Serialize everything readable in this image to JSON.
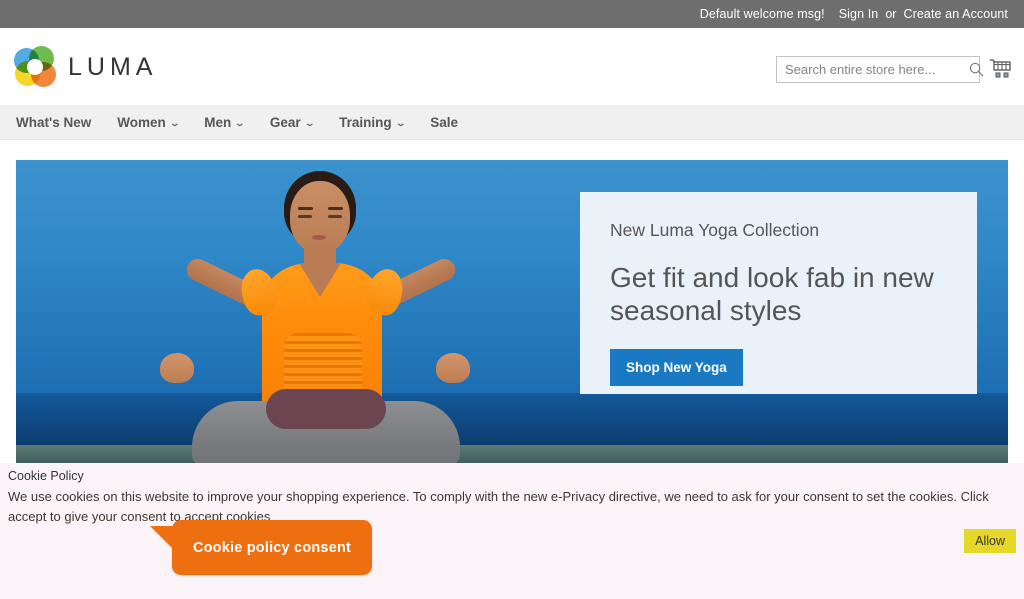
{
  "topbar": {
    "welcome": "Default welcome msg!",
    "sign_in": "Sign In",
    "separator": "or",
    "create_account": "Create an Account"
  },
  "header": {
    "logo_text": "LUMA",
    "logo_icon": "luma-ring-logo",
    "search": {
      "placeholder": "Search entire store here...",
      "value": "",
      "icon": "search-icon"
    },
    "cart_icon": "shopping-cart-icon"
  },
  "nav": {
    "items": [
      {
        "label": "What's New",
        "has_caret": false
      },
      {
        "label": "Women",
        "has_caret": true
      },
      {
        "label": "Men",
        "has_caret": true
      },
      {
        "label": "Gear",
        "has_caret": true
      },
      {
        "label": "Training",
        "has_caret": true
      },
      {
        "label": "Sale",
        "has_caret": false
      }
    ],
    "caret_glyph": "⌄"
  },
  "hero": {
    "eyebrow": "New Luma Yoga Collection",
    "title": "Get fit and look fab in new seasonal styles",
    "cta_label": "Shop New Yoga",
    "image_alt": "Woman meditating in lotus pose on a beach wearing an orange top and grey yoga pants"
  },
  "cookie": {
    "title": "Cookie Policy",
    "text": "We use cookies on this website to improve your shopping experience. To comply with the new e-Privacy directive, we need to ask for your consent to set the cookies. Click accept to give your consent to accept cookies",
    "allow_label": "Allow"
  },
  "callout": {
    "label": "Cookie policy consent"
  },
  "colors": {
    "topbar_bg": "#6e6e6e",
    "nav_bg": "#f0f0f0",
    "cta_blue": "#1979c3",
    "callout_orange": "#ee6f10",
    "allow_yellow": "#e5d829",
    "cookie_bg": "#faf4f8",
    "panel_bg": "#e9f1f9"
  }
}
